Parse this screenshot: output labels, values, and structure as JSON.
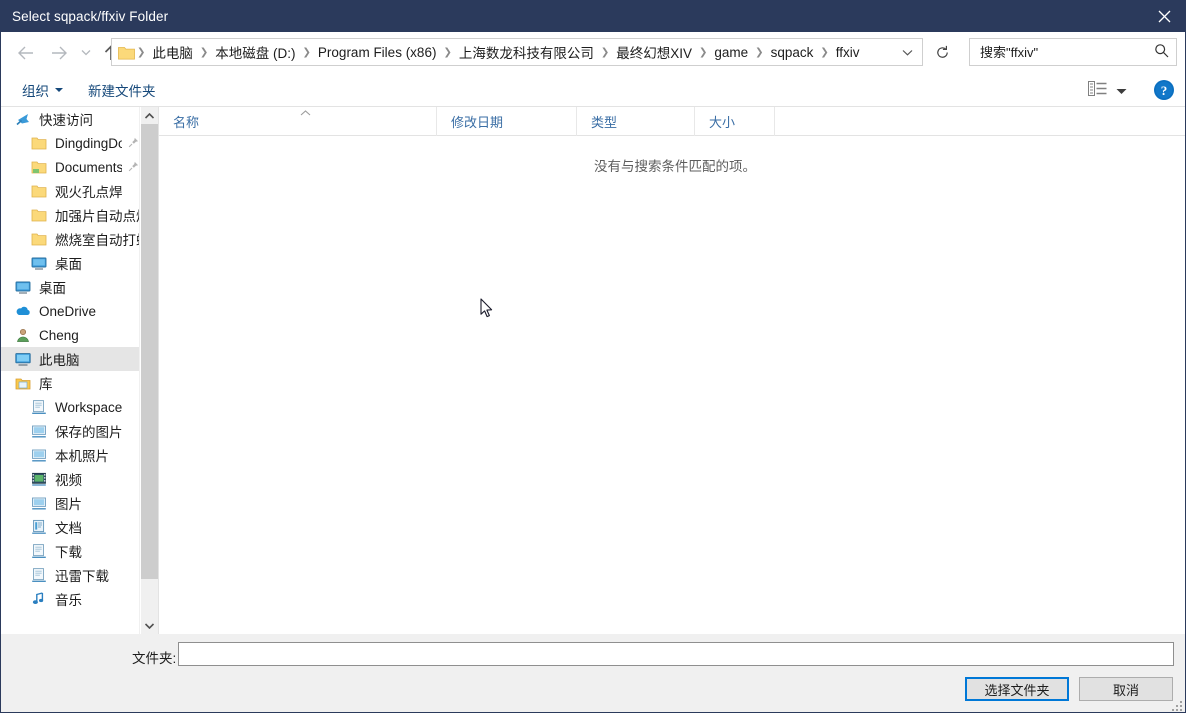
{
  "window": {
    "title": "Select sqpack/ffxiv Folder",
    "close_icon": "close-icon"
  },
  "nav": {
    "back_icon": "arrow-left-icon",
    "forward_icon": "arrow-right-icon",
    "recent_icon": "chevron-down-icon",
    "up_icon": "arrow-up-icon",
    "refresh_icon": "refresh-icon",
    "breadcrumb": [
      "此电脑",
      "本地磁盘 (D:)",
      "Program Files (x86)",
      "上海数龙科技有限公司",
      "最终幻想XIV",
      "game",
      "sqpack",
      "ffxiv"
    ],
    "breadcrumb_separator": "❯",
    "dropdown_icon": "chevron-down-icon"
  },
  "search": {
    "placeholder": "搜索\"ffxiv\"",
    "value": "",
    "icon": "search-icon"
  },
  "commandbar": {
    "organize_label": "组织",
    "new_folder_label": "新建文件夹",
    "view_icon": "view-layout-icon",
    "view_caret_icon": "chevron-down-icon",
    "help_icon": "help-icon"
  },
  "sidebar": {
    "items": [
      {
        "label": "快速访问",
        "icon": "quick-access-star-icon",
        "level": 1,
        "selected": false,
        "pinned": false
      },
      {
        "label": "DingdingDo",
        "icon": "folder-icon",
        "level": 2,
        "selected": false,
        "pinned": true
      },
      {
        "label": "Documents",
        "icon": "folder-documents-icon",
        "level": 2,
        "selected": false,
        "pinned": true
      },
      {
        "label": "观火孔点焊",
        "icon": "folder-icon",
        "level": 2,
        "selected": false,
        "pinned": false
      },
      {
        "label": "加强片自动点焊",
        "icon": "folder-icon",
        "level": 2,
        "selected": false,
        "pinned": false
      },
      {
        "label": "燃烧室自动打螺",
        "icon": "folder-icon",
        "level": 2,
        "selected": false,
        "pinned": false
      },
      {
        "label": "桌面",
        "icon": "desktop-icon",
        "level": 2,
        "selected": false,
        "pinned": false
      },
      {
        "label": "桌面",
        "icon": "desktop-icon",
        "level": 1,
        "selected": false,
        "pinned": false
      },
      {
        "label": "OneDrive",
        "icon": "onedrive-cloud-icon",
        "level": 1,
        "selected": false,
        "pinned": false
      },
      {
        "label": "Cheng",
        "icon": "user-account-icon",
        "level": 1,
        "selected": false,
        "pinned": false
      },
      {
        "label": "此电脑",
        "icon": "this-pc-icon",
        "level": 1,
        "selected": true,
        "pinned": false
      },
      {
        "label": "库",
        "icon": "library-icon",
        "level": 1,
        "selected": false,
        "pinned": false
      },
      {
        "label": "Workspace",
        "icon": "library-item-icon",
        "level": 2,
        "selected": false,
        "pinned": false
      },
      {
        "label": "保存的图片",
        "icon": "library-pictures-icon",
        "level": 2,
        "selected": false,
        "pinned": false
      },
      {
        "label": "本机照片",
        "icon": "library-pictures-icon",
        "level": 2,
        "selected": false,
        "pinned": false
      },
      {
        "label": "视频",
        "icon": "library-videos-icon",
        "level": 2,
        "selected": false,
        "pinned": false
      },
      {
        "label": "图片",
        "icon": "library-pictures-icon",
        "level": 2,
        "selected": false,
        "pinned": false
      },
      {
        "label": "文档",
        "icon": "library-documents-icon",
        "level": 2,
        "selected": false,
        "pinned": false
      },
      {
        "label": "下载",
        "icon": "library-item-icon",
        "level": 2,
        "selected": false,
        "pinned": false
      },
      {
        "label": "迅雷下载",
        "icon": "library-item-icon",
        "level": 2,
        "selected": false,
        "pinned": false
      },
      {
        "label": "音乐",
        "icon": "library-music-icon",
        "level": 2,
        "selected": false,
        "pinned": false
      }
    ],
    "scroll_up_icon": "chevron-up-icon",
    "scroll_down_icon": "chevron-down-icon"
  },
  "filelist": {
    "columns": [
      {
        "id": "name",
        "label": "名称",
        "sorted": true,
        "sort_icon": "sort-ascending-caret"
      },
      {
        "id": "date",
        "label": "修改日期",
        "sorted": false
      },
      {
        "id": "type",
        "label": "类型",
        "sorted": false
      },
      {
        "id": "size",
        "label": "大小",
        "sorted": false
      }
    ],
    "rows": [],
    "empty_message": "没有与搜索条件匹配的项。"
  },
  "footer": {
    "folder_label": "文件夹:",
    "folder_value": "",
    "select_button": "选择文件夹",
    "cancel_button": "取消"
  },
  "colors": {
    "titlebar": "#2b3a5c",
    "accent": "#0078d7",
    "command_link": "#15487a",
    "column_header": "#3a6ea5",
    "dialog_bg": "#f0f0f0"
  }
}
